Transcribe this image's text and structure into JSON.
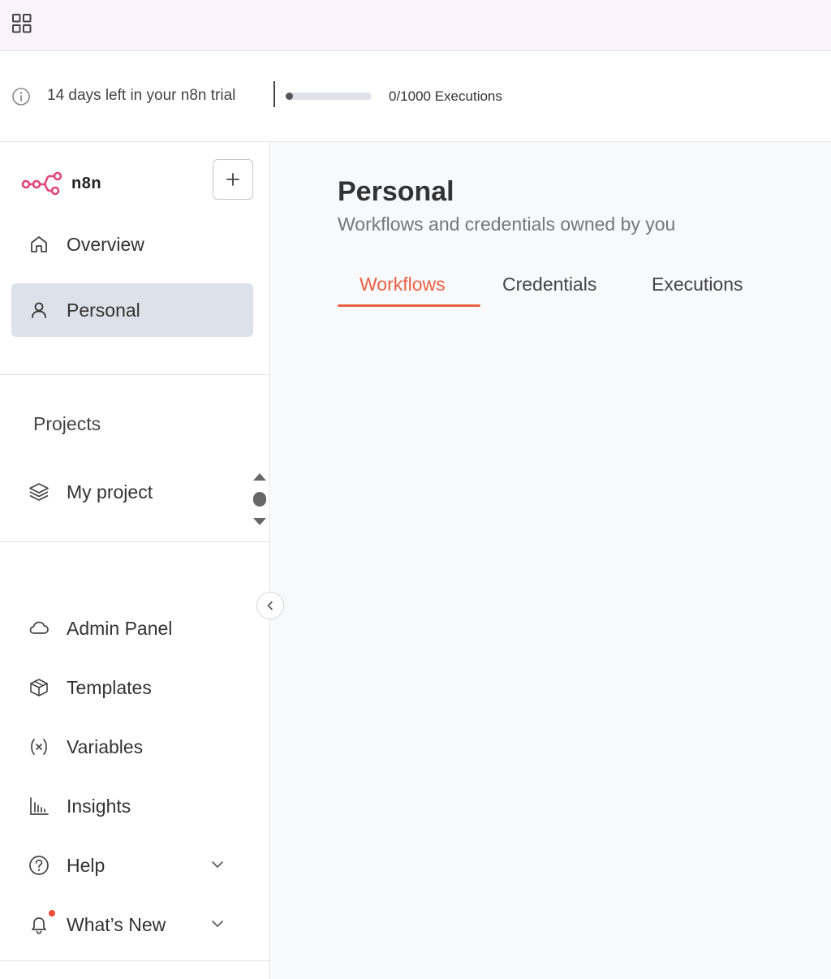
{
  "topbar": {
    "apps_icon": "grid-icon"
  },
  "trial": {
    "text": "14 days left in your n8n trial",
    "executions_text": "0/1000 Executions",
    "progress": 0.0
  },
  "sidebar": {
    "logo_text": "n8n",
    "add_icon": "plus-icon",
    "nav": [
      {
        "label": "Overview",
        "icon": "home-icon"
      },
      {
        "label": "Personal",
        "icon": "user-icon",
        "active": true
      }
    ],
    "projects_heading": "Projects",
    "projects": [
      {
        "label": "My project",
        "icon": "layers-icon"
      }
    ],
    "bottom": [
      {
        "label": "Admin Panel",
        "icon": "cloud-icon"
      },
      {
        "label": "Templates",
        "icon": "box-icon"
      },
      {
        "label": "Variables",
        "icon": "variable-icon"
      },
      {
        "label": "Insights",
        "icon": "bar-chart-icon"
      },
      {
        "label": "Help",
        "icon": "help-circle-icon"
      },
      {
        "label": "What’s New",
        "icon": "bell-icon"
      }
    ]
  },
  "main": {
    "title": "Personal",
    "subtitle": "Workflows and credentials owned by you",
    "tabs": [
      {
        "label": "Workflows",
        "active": true
      },
      {
        "label": "Credentials"
      },
      {
        "label": "Executions"
      }
    ]
  },
  "colors": {
    "accent": "#ea6144",
    "logo": "#e0467a",
    "active_bg": "#dde1ea",
    "notification": "#ea4b35"
  }
}
